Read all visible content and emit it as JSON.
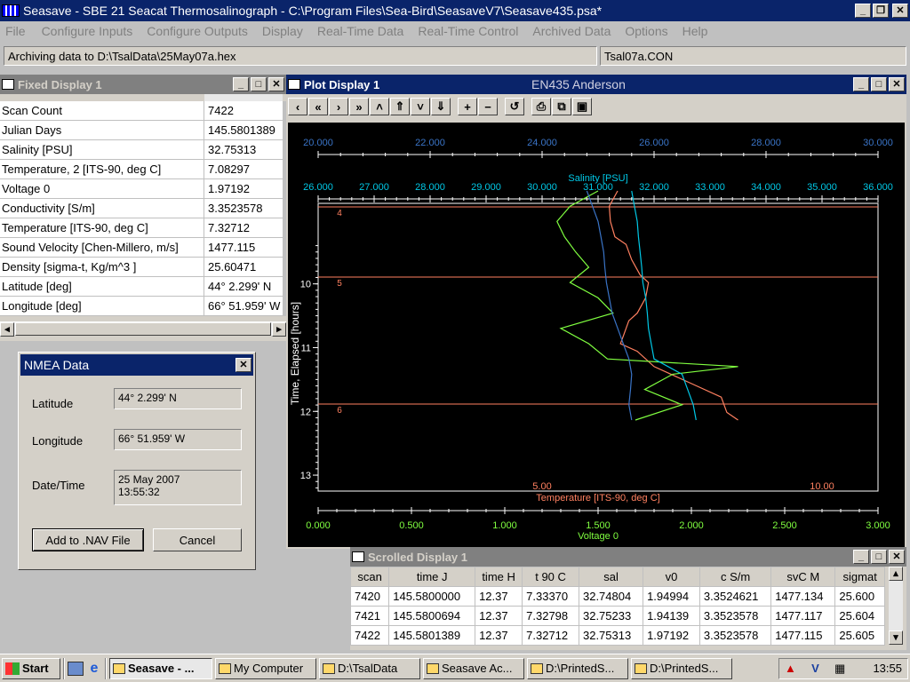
{
  "app": {
    "title": "Seasave - SBE 21 Seacat Thermosalinograph - C:\\Program Files\\Sea-Bird\\SeasaveV7\\Seasave435.psa*",
    "menu": [
      "File",
      "Configure Inputs",
      "Configure Outputs",
      "Display",
      "Real-Time Data",
      "Real-Time Control",
      "Archived Data",
      "Options",
      "Help"
    ],
    "status_left": "Archiving data to D:\\TsalData\\25May07a.hex",
    "status_right": "Tsal07a.CON"
  },
  "fixed_display": {
    "title": "Fixed Display 1",
    "rows": [
      {
        "label": "Scan Count",
        "value": "7422"
      },
      {
        "label": "Julian Days",
        "value": "145.5801389"
      },
      {
        "label": "Salinity [PSU]",
        "value": "32.75313"
      },
      {
        "label": "Temperature, 2 [ITS-90, deg C]",
        "value": "7.08297"
      },
      {
        "label": "Voltage 0",
        "value": "1.97192"
      },
      {
        "label": "Conductivity [S/m]",
        "value": "3.3523578"
      },
      {
        "label": "Temperature [ITS-90, deg C]",
        "value": "7.32712"
      },
      {
        "label": "Sound Velocity [Chen-Millero, m/s]",
        "value": "1477.115"
      },
      {
        "label": "Density [sigma-t, Kg/m^3 ]",
        "value": "25.60471"
      },
      {
        "label": "Latitude [deg]",
        "value": " 44° 2.299' N"
      },
      {
        "label": "Longitude [deg]",
        "value": "66° 51.959' W"
      }
    ]
  },
  "nmea": {
    "title": "NMEA Data",
    "lat_label": "Latitude",
    "lat_value": "44° 2.299' N",
    "lon_label": "Longitude",
    "lon_value": "66° 51.959' W",
    "dt_label": "Date/Time",
    "date_value": "25 May 2007",
    "time_value": "13:55:32",
    "add_button": "Add to .NAV File",
    "cancel_button": "Cancel"
  },
  "plot": {
    "window_title": "Plot Display 1",
    "cruise": "EN435 Anderson"
  },
  "chart_data": {
    "type": "line",
    "y_axis": {
      "label": "Time, Elapsed [hours]",
      "ticks": [
        "10",
        "11",
        "12",
        "13"
      ],
      "range": [
        9.35,
        13.25
      ],
      "inverted": true
    },
    "axes_top": [
      {
        "label": "Density [sigma-t, Kg/m^3 ]",
        "ticks": [
          "20.000",
          "22.000",
          "24.000",
          "26.000",
          "28.000",
          "30.000"
        ],
        "range": [
          20,
          30
        ],
        "color": "#3a74c7"
      },
      {
        "label": "Salinity [PSU]",
        "ticks": [
          "26.000",
          "27.000",
          "28.000",
          "29.000",
          "30.000",
          "31.000",
          "32.000",
          "33.000",
          "34.000",
          "35.000",
          "36.000"
        ],
        "range": [
          26,
          36
        ],
        "color": "#00c8e6"
      }
    ],
    "axes_bottom": [
      {
        "label": "Temperature [ITS-90, deg C]",
        "ticks": [
          "5.00",
          "10.00"
        ],
        "range": [
          1,
          11
        ],
        "color": "#ff8060"
      },
      {
        "label": "Voltage 0",
        "ticks": [
          "0.000",
          "0.500",
          "1.000",
          "1.500",
          "2.000",
          "2.500",
          "3.000"
        ],
        "range": [
          0,
          3
        ],
        "color": "#80ff40"
      }
    ],
    "markers": [
      {
        "label": "4",
        "y": 9.55
      },
      {
        "label": "5",
        "y": 10.57
      },
      {
        "label": "6",
        "y": 11.36
      }
    ],
    "series": [
      {
        "name": "Temperature [ITS-90, deg C]",
        "color": "#ff8060",
        "axis": "Temperature [ITS-90, deg C]",
        "y": [
          9.4,
          9.6,
          9.8,
          10.0,
          10.1,
          10.3,
          10.5,
          10.6,
          10.8,
          11.0,
          11.1,
          11.3,
          11.4,
          11.5,
          11.7,
          11.9,
          12.1,
          12.3,
          12.4
        ],
        "x": [
          6.35,
          6.2,
          6.22,
          6.3,
          6.5,
          6.6,
          6.75,
          6.9,
          6.85,
          6.7,
          6.55,
          6.45,
          6.4,
          6.7,
          7.0,
          7.6,
          8.2,
          8.3,
          8.5
        ]
      },
      {
        "name": "Voltage 0",
        "color": "#80ff40",
        "axis": "Voltage 0",
        "y": [
          9.4,
          9.6,
          9.8,
          10.0,
          10.2,
          10.4,
          10.6,
          10.8,
          11.0,
          11.2,
          11.4,
          11.6,
          11.7,
          11.8,
          12.0,
          12.2,
          12.4
        ],
        "x": [
          1.5,
          1.35,
          1.28,
          1.32,
          1.38,
          1.45,
          1.35,
          1.5,
          1.58,
          1.3,
          1.45,
          1.55,
          2.25,
          1.9,
          1.75,
          1.95,
          1.7
        ]
      },
      {
        "name": "Density [sigma-t, Kg/m^3 ]",
        "color": "#3a74c7",
        "axis": "Density [sigma-t, Kg/m^3 ]",
        "y": [
          9.4,
          9.6,
          9.8,
          10.0,
          10.2,
          10.4,
          10.6,
          10.8,
          11.0,
          11.2,
          11.4,
          11.6,
          11.8,
          12.0,
          12.2,
          12.4
        ],
        "x": [
          24.8,
          24.9,
          25.0,
          25.05,
          25.1,
          25.12,
          25.15,
          25.2,
          25.25,
          25.35,
          25.45,
          25.55,
          25.6,
          25.58,
          25.55,
          25.6
        ]
      },
      {
        "name": "Salinity [PSU]",
        "color": "#00c8e6",
        "axis": "Salinity [PSU]",
        "y": [
          9.4,
          9.6,
          9.8,
          10.0,
          10.2,
          10.4,
          10.6,
          10.8,
          11.0,
          11.2,
          11.4,
          11.6,
          11.8,
          12.0,
          12.2,
          12.4
        ],
        "x": [
          31.6,
          31.65,
          31.7,
          31.72,
          31.75,
          31.78,
          31.8,
          31.85,
          31.88,
          31.9,
          31.95,
          32.0,
          32.5,
          32.6,
          32.7,
          32.75
        ]
      }
    ]
  },
  "scrolled": {
    "title": "Scrolled Display 1",
    "columns": [
      "scan",
      "time J",
      "time H",
      "t 90 C",
      "sal",
      "v0",
      "c S/m",
      "svC M",
      "sigmat"
    ],
    "rows": [
      [
        "7420",
        "145.5800000",
        "12.37",
        "7.33370",
        "32.74804",
        "1.94994",
        "3.3524621",
        "1477.134",
        "25.600"
      ],
      [
        "7421",
        "145.5800694",
        "12.37",
        "7.32798",
        "32.75233",
        "1.94139",
        "3.3523578",
        "1477.117",
        "25.604"
      ],
      [
        "7422",
        "145.5801389",
        "12.37",
        "7.32712",
        "32.75313",
        "1.97192",
        "3.3523578",
        "1477.115",
        "25.605"
      ]
    ]
  },
  "taskbar": {
    "start": "Start",
    "items": [
      "Seasave - ...",
      "My Computer",
      "D:\\TsalData",
      "Seasave Ac...",
      "D:\\PrintedS...",
      "D:\\PrintedS..."
    ],
    "clock": "13:55"
  }
}
